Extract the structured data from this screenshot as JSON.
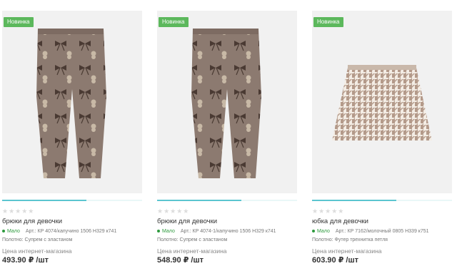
{
  "products": [
    {
      "badge": "Новинка",
      "name": "брюки для девочки",
      "stock": "Мало",
      "article": "Арт.: КР 4074/капучино 1506 Н329 к741",
      "fabric": "Полотно: Супрем с эластаном",
      "price_label": "Цена интернет-магазина",
      "price": "493.90 ₽ /шт",
      "rating": "★★★★★",
      "image_icon": "leggings-image",
      "progress": 0.6
    },
    {
      "badge": "Новинка",
      "name": "брюки для девочки",
      "stock": "Мало",
      "article": "Арт.: КР 4074-1/капучино 1506 Н329 к741",
      "fabric": "Полотно: Супрем с эластаном",
      "price_label": "Цена интернет-магазина",
      "price": "548.90 ₽ /шт",
      "rating": "★★★★★",
      "image_icon": "leggings-image",
      "progress": 0.6
    },
    {
      "badge": "Новинка",
      "name": "юбка для девочки",
      "stock": "Мало",
      "article": "Арт.: КР 7162/молочный 0805 Н339 к751",
      "fabric": "Полотно: Футер трехнитка петля",
      "price_label": "Цена интернет-магазина",
      "price": "603.90 ₽ /шт",
      "rating": "★★★★★",
      "image_icon": "skirt-image",
      "progress": 0.6
    }
  ],
  "colors": {
    "badge": "#5cb85c",
    "stock": "#2e9a3e",
    "bar": "#5bc5d0",
    "photo_bg": "#f1f1f1"
  }
}
